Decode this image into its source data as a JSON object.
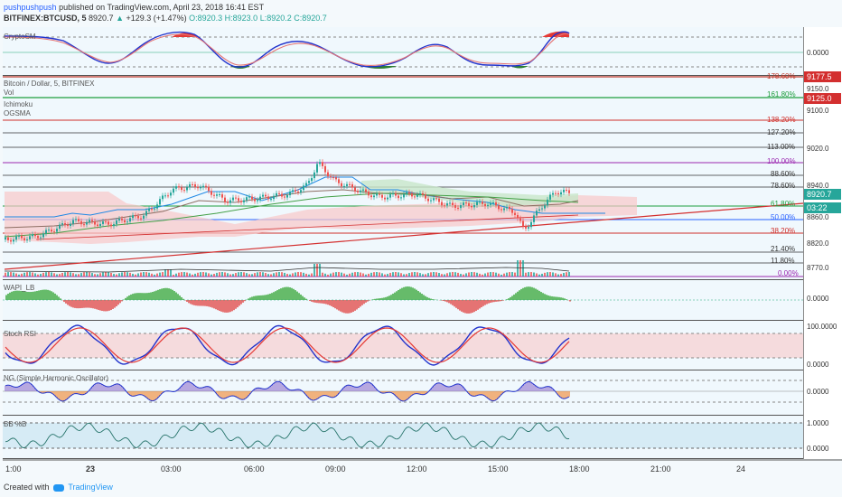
{
  "header": {
    "author": "pushpushpush",
    "published": "published on TradingView.com, April 23, 2018 16:41 EST",
    "symbol": "BITFINEX:BTCUSD, 5",
    "last": "8920.7",
    "change": "+129.3 (+1.47%)",
    "open": "O:8920.3",
    "high": "H:8923.0",
    "low": "L:8920.2",
    "close": "C:8920.7"
  },
  "panes": {
    "cryptosm": {
      "label": "CryptoSM",
      "axis": "0.0000"
    },
    "main": {
      "labels": [
        "Bitcoin / Dollar, 5, BITFINEX",
        "Vol",
        "Ichimoku",
        "OGSMA"
      ],
      "axis": [
        "9150.0",
        "9100.0",
        "9020.0",
        "8940.0",
        "8860.0",
        "8820.0",
        "8770.0"
      ],
      "badges": {
        "fib_top": "9177.5",
        "fib_1618": "9125.0",
        "price": "8920.7",
        "countdown": "03:22"
      },
      "fibs": [
        {
          "label": "178.60%",
          "color": "#c0392b"
        },
        {
          "label": "161.80%",
          "color": "#1e9e3e"
        },
        {
          "label": "138.20%",
          "color": "#d0302b"
        },
        {
          "label": "127.20%",
          "color": "#333333"
        },
        {
          "label": "113.00%",
          "color": "#333333"
        },
        {
          "label": "100.00%",
          "color": "#9b27b0"
        },
        {
          "label": "88.60%",
          "color": "#333333"
        },
        {
          "label": "78.60%",
          "color": "#333333"
        },
        {
          "label": "61.80%",
          "color": "#1e9e3e"
        },
        {
          "label": "50.00%",
          "color": "#2962ff"
        },
        {
          "label": "38.20%",
          "color": "#d0302b"
        },
        {
          "label": "21.40%",
          "color": "#333333"
        },
        {
          "label": "11.80%",
          "color": "#333333"
        },
        {
          "label": "0.00%",
          "color": "#9b27b0"
        }
      ]
    },
    "wapi": {
      "label": "WAPI_LB",
      "axis": "0.0000"
    },
    "stoch": {
      "label": "Stoch RSI",
      "axis_top": "100.0000",
      "axis_bottom": "0.0000"
    },
    "ng": {
      "label": "NG (Simple Harmonic Oscillator)",
      "axis": "0.0000"
    },
    "bb": {
      "label": "BB %B",
      "axis_top": "1.0000",
      "axis_bottom": "0.0000"
    }
  },
  "xaxis": [
    "1:00",
    "23",
    "03:00",
    "06:00",
    "09:00",
    "12:00",
    "15:00",
    "18:00",
    "21:00",
    "24"
  ],
  "footer": {
    "created": "Created with",
    "brand": "TradingView"
  },
  "colors": {
    "up": "#26a69a",
    "down": "#ef5350",
    "fib_red": "#c0392b",
    "fib_green": "#1e9e3e",
    "price_green": "#26a69a"
  }
}
